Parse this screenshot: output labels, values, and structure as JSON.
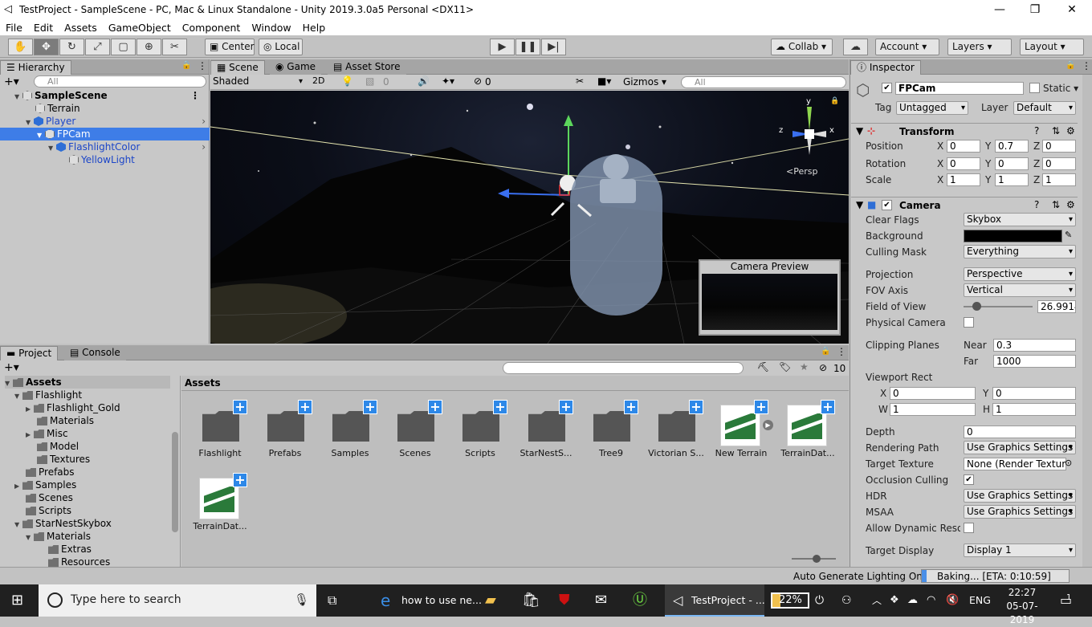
{
  "window": {
    "title": "TestProject - SampleScene - PC, Mac & Linux Standalone - Unity 2019.3.0a5 Personal <DX11>"
  },
  "menu": [
    "File",
    "Edit",
    "Assets",
    "GameObject",
    "Component",
    "Window",
    "Help"
  ],
  "toolbar": {
    "center": "Center",
    "local": "Local",
    "collab": "Collab",
    "account": "Account",
    "layers": "Layers",
    "layout": "Layout"
  },
  "hierarchy": {
    "tab": "Hierarchy",
    "search_placeholder": "All",
    "scene": "SampleScene",
    "items": [
      "Terrain",
      "Player",
      "FPCam",
      "FlashlightColor",
      "YellowLight"
    ]
  },
  "scene": {
    "tabs": [
      "Scene",
      "Game",
      "Asset Store"
    ],
    "shading": "Shaded",
    "mode2d": "2D",
    "fx_count": "0",
    "hidden_count": "0",
    "gizmos": "Gizmos",
    "search_placeholder": "All",
    "persp": "Persp",
    "preview_title": "Camera Preview",
    "axis_z": "z",
    "axis_y": "y",
    "axis_x": "x"
  },
  "inspector": {
    "tab": "Inspector",
    "object_name": "FPCam",
    "static_label": "Static",
    "tag_label": "Tag",
    "tag": "Untagged",
    "layer_label": "Layer",
    "layer": "Default",
    "transform": {
      "title": "Transform",
      "rows": [
        {
          "label": "Position",
          "x": "0",
          "y": "0.7",
          "z": "0"
        },
        {
          "label": "Rotation",
          "x": "0",
          "y": "0",
          "z": "0"
        },
        {
          "label": "Scale",
          "x": "1",
          "y": "1",
          "z": "1"
        }
      ]
    },
    "camera": {
      "title": "Camera",
      "clear_flags_label": "Clear Flags",
      "clear_flags": "Skybox",
      "background_label": "Background",
      "culling_label": "Culling Mask",
      "culling": "Everything",
      "projection_label": "Projection",
      "projection": "Perspective",
      "fov_axis_label": "FOV Axis",
      "fov_axis": "Vertical",
      "fov_label": "Field of View",
      "fov": "26.9914",
      "fov_slider_fraction": 0.19,
      "physical_label": "Physical Camera",
      "clipping_label": "Clipping Planes",
      "near_label": "Near",
      "near": "0.3",
      "far_label": "Far",
      "far": "1000",
      "viewport_label": "Viewport Rect",
      "vx": "0",
      "vy": "0",
      "vw": "1",
      "vh": "1",
      "depth_label": "Depth",
      "depth": "0",
      "rendering_path_label": "Rendering Path",
      "rendering_path": "Use Graphics Settings",
      "target_texture_label": "Target Texture",
      "target_texture": "None (Render Textur",
      "occlusion_label": "Occlusion Culling",
      "hdr_label": "HDR",
      "hdr": "Use Graphics Settings",
      "msaa_label": "MSAA",
      "msaa": "Use Graphics Settings",
      "dyn_res_label": "Allow Dynamic Resol",
      "target_display_label": "Target Display",
      "target_display": "Display 1"
    }
  },
  "project": {
    "tabs": [
      "Project",
      "Console"
    ],
    "hidden_count": "10",
    "breadcrumb": "Assets",
    "tree": [
      "Assets",
      "Flashlight",
      "Flashlight_Gold",
      "Materials",
      "Misc",
      "Model",
      "Textures",
      "Prefabs",
      "Samples",
      "Scenes",
      "Scripts",
      "StarNestSkybox",
      "Materials",
      "Extras",
      "Resources"
    ],
    "assets": [
      "Flashlight",
      "Prefabs",
      "Samples",
      "Scenes",
      "Scripts",
      "StarNestS...",
      "Tree9",
      "Victorian S...",
      "New Terrain",
      "TerrainDat...",
      "TerrainDat..."
    ]
  },
  "status": {
    "auto_lighting": "Auto Generate Lighting On",
    "baking": "Baking... [ETA: 0:10:59]"
  },
  "taskbar": {
    "search": "Type here to search",
    "edge_title": "how to use ne...",
    "unity_title": "TestProject - ...",
    "battery": "22%",
    "lang": "ENG",
    "time": "22:27",
    "date": "05-07-2019",
    "notif": "1"
  }
}
